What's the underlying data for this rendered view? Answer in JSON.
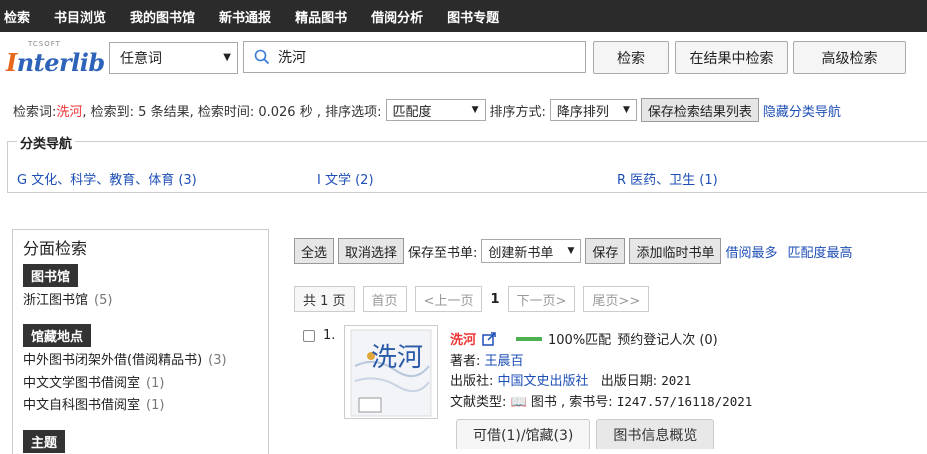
{
  "nav": [
    "检索",
    "书目浏览",
    "我的图书馆",
    "新书通报",
    "精品图书",
    "借阅分析",
    "图书专题"
  ],
  "logo": {
    "small": "TCSOFT",
    "brand_i": "I",
    "brand_rest": "nterlib"
  },
  "search": {
    "field": "任意词",
    "query": "洗河",
    "btn_search": "检索",
    "btn_in_results": "在结果中检索",
    "btn_advanced": "高级检索"
  },
  "info": {
    "kw_label": "检索词:",
    "kw": "洗河",
    "summary": ", 检索到: 5 条结果, 检索时间: 0.026 秒 , 排序选项:",
    "sort_option": "匹配度",
    "sort_label": "排序方式:",
    "sort_order": "降序排列",
    "save_btn": "保存检索结果列表",
    "hide_link": "隐藏分类导航"
  },
  "classnav": {
    "title": "分类导航",
    "items": [
      "G 文化、科学、教育、体育 (3)",
      "I 文学 (2)",
      "R 医药、卫生 (1)"
    ]
  },
  "facet": {
    "title": "分面检索",
    "groups": [
      {
        "head": "图书馆",
        "items": [
          {
            "label": "浙江图书馆",
            "count": "(5)"
          }
        ]
      },
      {
        "head": "馆藏地点",
        "items": [
          {
            "label": "中外图书闭架外借(借阅精品书)",
            "count": "(3)"
          },
          {
            "label": "中文文学图书借阅室",
            "count": "(1)"
          },
          {
            "label": "中文自科图书借阅室",
            "count": "(1)"
          }
        ]
      },
      {
        "head": "主题",
        "items": []
      }
    ]
  },
  "toolbar": {
    "select_all": "全选",
    "deselect": "取消选择",
    "save_to_label": "保存至书单:",
    "list_select": "创建新书单",
    "save": "保存",
    "add_temp": "添加临时书单",
    "most_borrowed": "借阅最多",
    "best_match": "匹配度最高"
  },
  "pager": {
    "total": "共 1 页",
    "first": "首页",
    "prev": "<上一页",
    "current": "1",
    "next": "下一页>",
    "last": "尾页>>"
  },
  "result": {
    "index": "1.",
    "title": "洗河",
    "match": "100%匹配",
    "reserve": "预约登记人次 (0)",
    "author_label": "著者:",
    "author": "王晨百",
    "publisher_label": "出版社:",
    "publisher": "中国文史出版社",
    "date_label": "出版日期:",
    "date": "2021",
    "type_label": "文献类型:",
    "type": "图书",
    "callno_label": ", 索书号:",
    "callno": "I247.57/16118/2021",
    "tab_avail": "可借(1)/馆藏(3)",
    "tab_overview": "图书信息概览",
    "cover_text": "洗河"
  },
  "colors": {
    "accent": "#1e4fb6",
    "keyword": "#e33333",
    "nav_bg": "#2b2b2b",
    "match_bar": "#4caf50"
  }
}
